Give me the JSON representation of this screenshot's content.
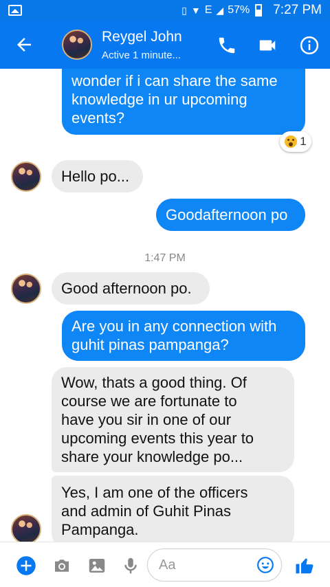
{
  "status_bar": {
    "battery": "57%",
    "time": "7:27 PM",
    "network": "E"
  },
  "header": {
    "contact_name": "Reygel John",
    "status": "Active 1 minute..."
  },
  "messages": [
    {
      "direction": "out",
      "text_lines": [
        "wonder if i can share the same",
        "knowledge in ur upcoming",
        "events?"
      ],
      "reaction": {
        "emoji": "wow",
        "count": "1"
      }
    },
    {
      "direction": "in",
      "text_lines": [
        "Hello po..."
      ]
    },
    {
      "direction": "out",
      "text_lines": [
        "Goodafternoon po"
      ]
    },
    {
      "timestamp": "1:47 PM"
    },
    {
      "direction": "in",
      "text_lines": [
        "Good afternoon po."
      ]
    },
    {
      "direction": "out",
      "text_lines": [
        "Are you in any connection with",
        "guhit pinas pampanga?"
      ]
    },
    {
      "direction": "in",
      "text_lines": [
        "Wow, thats a good thing. Of",
        "course we are fortunate to",
        "have you sir in one of our",
        "upcoming events this year to",
        "share your knowledge po..."
      ]
    },
    {
      "direction": "in",
      "text_lines": [
        "Yes, I am one of the officers",
        "and admin of Guhit Pinas",
        "Pampanga."
      ]
    }
  ],
  "composer": {
    "placeholder": "Aa"
  },
  "colors": {
    "brand": "#0878f0",
    "outgoing": "#0f86f5",
    "incoming": "#ebebeb"
  }
}
